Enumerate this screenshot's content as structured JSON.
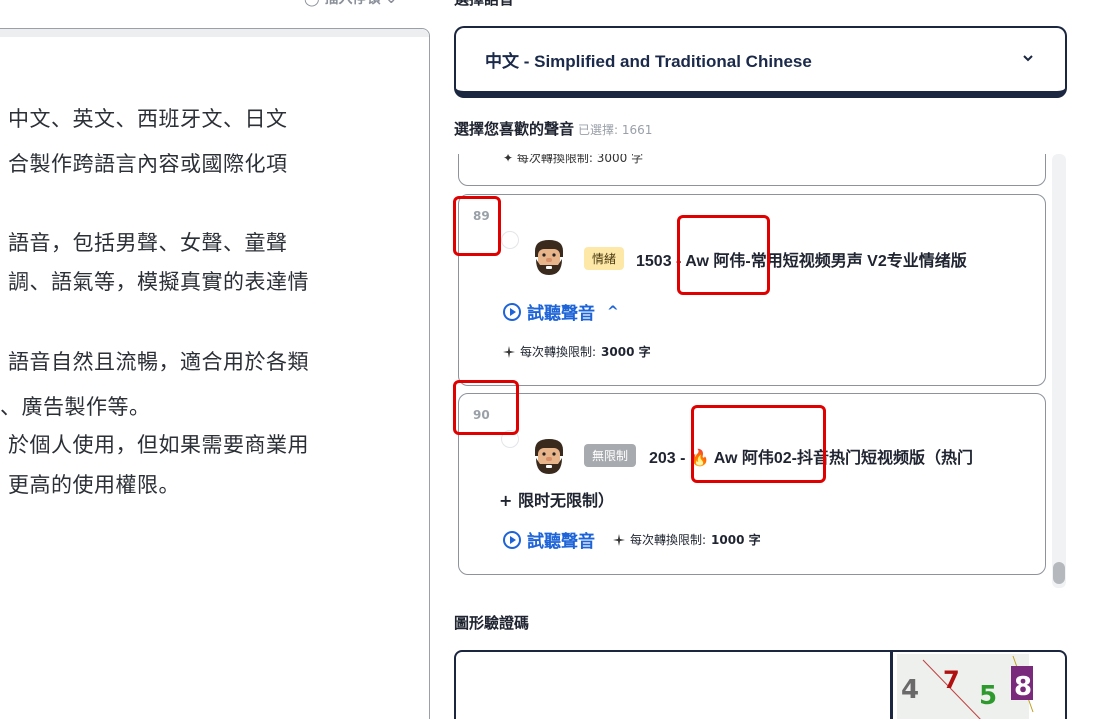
{
  "top": {
    "insert_tag_label": "◯ 插入停頓 ⌄",
    "language_heading": "選擇語音"
  },
  "left_text": {
    "lines": [
      "中文、英文、西班牙文、日文",
      "合製作跨語言內容或國際化項",
      "語音，包括男聲、女聲、童聲",
      "調、語氣等，模擬真實的表達情",
      "語音自然且流暢，適合用於各類",
      "、廣告製作等。",
      "於個人使用，但如果需要商業用",
      "更高的使用權限。"
    ]
  },
  "language_select": {
    "value": "中文 - Simplified and Traditional Chinese",
    "chevron_icon": "chevron-down-icon"
  },
  "voice_section": {
    "title": "選擇您喜歡的聲音",
    "selected_count": "已選擇: 1661",
    "top_card_cut_text": "✦ 每次轉換限制: 3000 字",
    "cards": [
      {
        "index": "89",
        "badge": "情緒",
        "name": "1503 - Aw 阿伟-常用短视频男声 V2专业情绪版",
        "play_label": "試聽聲音",
        "caret": "^",
        "limit_label": "每次轉換限制:",
        "limit_value": "3000 字"
      },
      {
        "index": "90",
        "badge": "無限制",
        "name": "203 - 🔥 Aw 阿伟02-抖音热门短视频版（热门",
        "name_line2": "+ 限时无限制）",
        "play_label": "試聽聲音",
        "limit_label": "每次轉換限制:",
        "limit_value": "1000 字"
      }
    ]
  },
  "captcha": {
    "title": "圖形驗證碼",
    "image_text": "4758"
  },
  "colors": {
    "accent_blue": "#1d64d8",
    "navy_border": "#1b2740",
    "annotation_red": "#e00000",
    "emotion_badge_bg": "#fde8a8",
    "unlimited_badge_bg": "#a7aaae"
  }
}
